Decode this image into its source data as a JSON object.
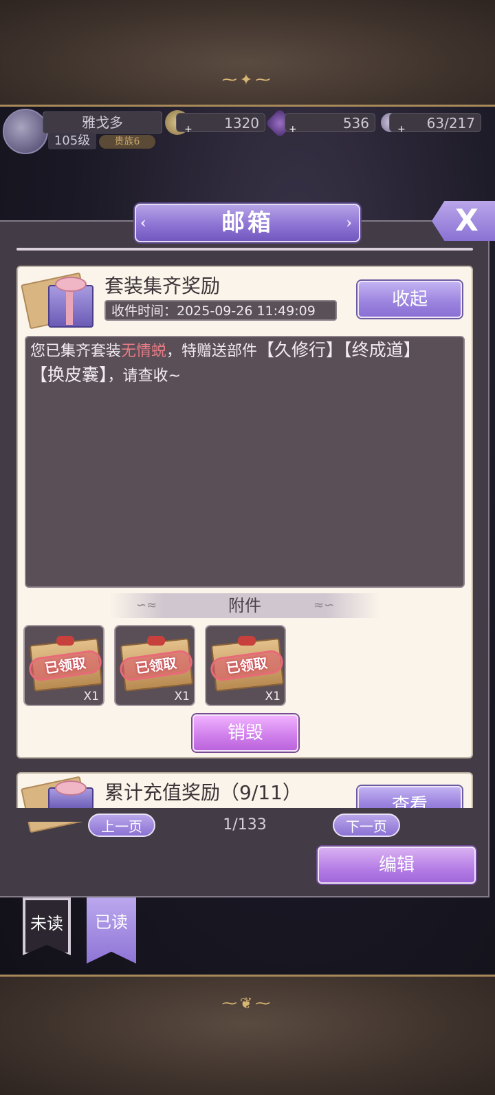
{
  "player": {
    "name": "雅戈多",
    "level": "105级",
    "vip": "贵族6"
  },
  "resources": {
    "coins": "1320",
    "diamonds": "536",
    "stamina": "63/217"
  },
  "mailbox": {
    "title": "邮箱",
    "close_label": "X"
  },
  "mail": {
    "title": "套装集齐奖励",
    "time": "收件时间：2025-09-26 11:49:09",
    "collapse_label": "收起",
    "body_part1": "您已集齐套装",
    "body_highlight": "无情蜕",
    "body_part2": "，特赠送部件",
    "body_item1": "【久修行】",
    "body_item2": "【终成道】",
    "body_item3": "【换皮囊】",
    "body_part3": "，请查收~",
    "attachments_header": "附件",
    "attachments": [
      {
        "status": "已领取",
        "qty": "X1"
      },
      {
        "status": "已领取",
        "qty": "X1"
      },
      {
        "status": "已领取",
        "qty": "X1"
      }
    ],
    "destroy_label": "销毁"
  },
  "mail2": {
    "title": "累计充值奖励（9/11）",
    "view_label": "查看"
  },
  "pagination": {
    "prev_label": "上一页",
    "page": "1/133",
    "next_label": "下一页"
  },
  "edit_label": "编辑",
  "tabs": {
    "unread": "未读",
    "read": "已读"
  },
  "colors": {
    "accent_purple": "#8e74d4",
    "highlight_red": "#e77c86",
    "card_bg": "#fbf4ea"
  }
}
